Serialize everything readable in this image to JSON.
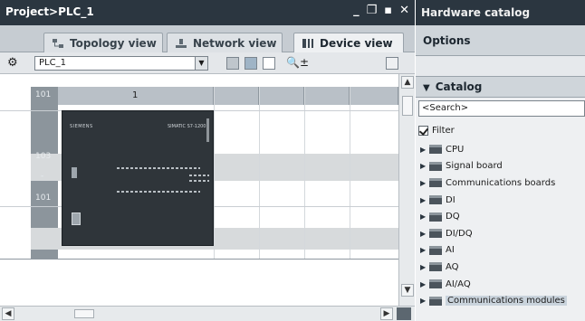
{
  "window": {
    "title": "Project>PLC_1",
    "controls": [
      "_",
      "❐",
      "▪",
      "✕"
    ]
  },
  "tabs": [
    {
      "label": "Topology view",
      "icon": "topology-icon"
    },
    {
      "label": "Network view",
      "icon": "network-icon"
    },
    {
      "label": "Device view",
      "icon": "device-icon",
      "active": true
    }
  ],
  "toolbar": {
    "device_selected": "PLC_1"
  },
  "rack": {
    "column_header": "1",
    "row_numbers": [
      "101",
      "103",
      "-",
      "101"
    ]
  },
  "module": {
    "brand": "SIEMENS",
    "model": "SIMATIC S7-1200"
  },
  "hardware_catalog": {
    "title": "Hardware catalog",
    "options_label": "Options",
    "catalog_label": "Catalog",
    "search_value": "<Search>",
    "filter_label": "Filter",
    "filter_checked": true,
    "items": [
      "CPU",
      "Signal board",
      "Communications boards",
      "DI",
      "DQ",
      "DI/DQ",
      "AI",
      "AQ",
      "AI/AQ",
      "Communications modules"
    ],
    "selected_item": "Communications modules"
  }
}
